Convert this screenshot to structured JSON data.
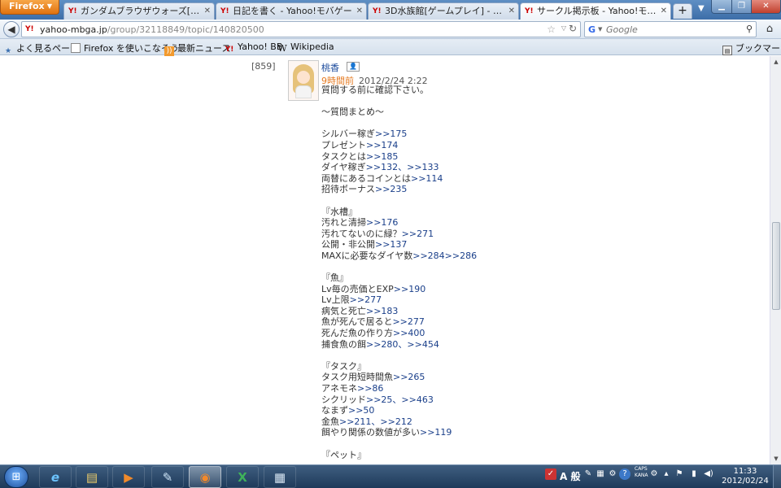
{
  "browser": {
    "menu_button": "Firefox",
    "tabs": [
      {
        "label": "ガンダムブラウザウォーズ[ゲーム...",
        "favicon": "Y!",
        "active": false
      },
      {
        "label": "日記を書く - Yahoo!モバゲー",
        "favicon": "Y!",
        "active": false
      },
      {
        "label": "3D水族館[ゲームプレイ] - Yahoo!...",
        "favicon": "Y!",
        "active": false
      },
      {
        "label": "サークル掲示板 - Yahoo!モバゲー",
        "favicon": "Y!",
        "active": true
      }
    ],
    "new_tab": "+",
    "url_host": "yahoo-mbga.jp",
    "url_path": "/group/32118849/topic/140820500",
    "search_placeholder": "Google",
    "bookmarks": [
      {
        "label": "よく見るページ",
        "icon": "bookmarks-icon"
      },
      {
        "label": "Firefox を使いこなそう",
        "icon": "page-icon"
      },
      {
        "label": "最新ニュース",
        "icon": "rss-icon"
      },
      {
        "label": "Yahoo! BB",
        "icon": "yahoo-icon"
      },
      {
        "label": "Wikipedia",
        "icon": "wikipedia-icon"
      }
    ],
    "bookmarks_menu": "ブックマーク"
  },
  "post": {
    "number": "[859]",
    "username": "桃香",
    "time_ago": "9時間前",
    "timestamp": "2012/2/24 2:22",
    "lines": [
      {
        "text": "質問する前に確認下さい。",
        "ref": ""
      },
      {
        "text": "",
        "ref": ""
      },
      {
        "text": "～質問まとめ～",
        "ref": ""
      },
      {
        "text": "",
        "ref": ""
      },
      {
        "text": "シルバー稼ぎ",
        "ref": ">>175"
      },
      {
        "text": "プレゼント",
        "ref": ">>174"
      },
      {
        "text": "タスクとは",
        "ref": ">>185"
      },
      {
        "text": "ダイヤ稼ぎ",
        "ref": ">>132、>>133"
      },
      {
        "text": "両替にあるコインとは",
        "ref": ">>114"
      },
      {
        "text": "招待ボーナス",
        "ref": ">>235"
      },
      {
        "text": "",
        "ref": ""
      },
      {
        "text": "『水槽』",
        "ref": ""
      },
      {
        "text": "汚れと清掃",
        "ref": ">>176"
      },
      {
        "text": "汚れてないのに緑？",
        "ref": ">>271"
      },
      {
        "text": "公開・非公開",
        "ref": ">>137"
      },
      {
        "text": "MAXに必要なダイヤ数",
        "ref": ">>284>>286"
      },
      {
        "text": "",
        "ref": ""
      },
      {
        "text": "『魚』",
        "ref": ""
      },
      {
        "text": "Lv毎の売価とEXP",
        "ref": ">>190"
      },
      {
        "text": "Lv上限",
        "ref": ">>277"
      },
      {
        "text": "病気と死亡",
        "ref": ">>183"
      },
      {
        "text": "魚が死んで居ると",
        "ref": ">>277"
      },
      {
        "text": "死んだ魚の作り方",
        "ref": ">>400"
      },
      {
        "text": "捕食魚の餌",
        "ref": ">>280、>>454"
      },
      {
        "text": "",
        "ref": ""
      },
      {
        "text": "『タスク』",
        "ref": ""
      },
      {
        "text": "タスク用短時間魚",
        "ref": ">>265"
      },
      {
        "text": "アネモネ",
        "ref": ">>86"
      },
      {
        "text": "シクリッド",
        "ref": ">>25、>>463"
      },
      {
        "text": "なまず",
        "ref": ">>50"
      },
      {
        "text": "金魚",
        "ref": ">>211、>>212"
      },
      {
        "text": "餌やり関係の数値が多い",
        "ref": ">>119"
      },
      {
        "text": "",
        "ref": ""
      },
      {
        "text": "『ペット』",
        "ref": ""
      }
    ]
  },
  "taskbar": {
    "apps": [
      {
        "name": "internet-explorer-icon",
        "glyph": "e"
      },
      {
        "name": "file-explorer-icon",
        "glyph": "▤"
      },
      {
        "name": "media-player-icon",
        "glyph": "▶"
      },
      {
        "name": "notepad-icon",
        "glyph": "✎"
      },
      {
        "name": "firefox-icon",
        "glyph": "◉"
      },
      {
        "name": "excel-icon",
        "glyph": "X"
      },
      {
        "name": "calculator-icon",
        "glyph": "▦"
      }
    ],
    "ime_label": "A 般",
    "caps_label": "CAPS",
    "kana_label": "KANA",
    "time": "11:33",
    "date": "2012/02/24"
  }
}
